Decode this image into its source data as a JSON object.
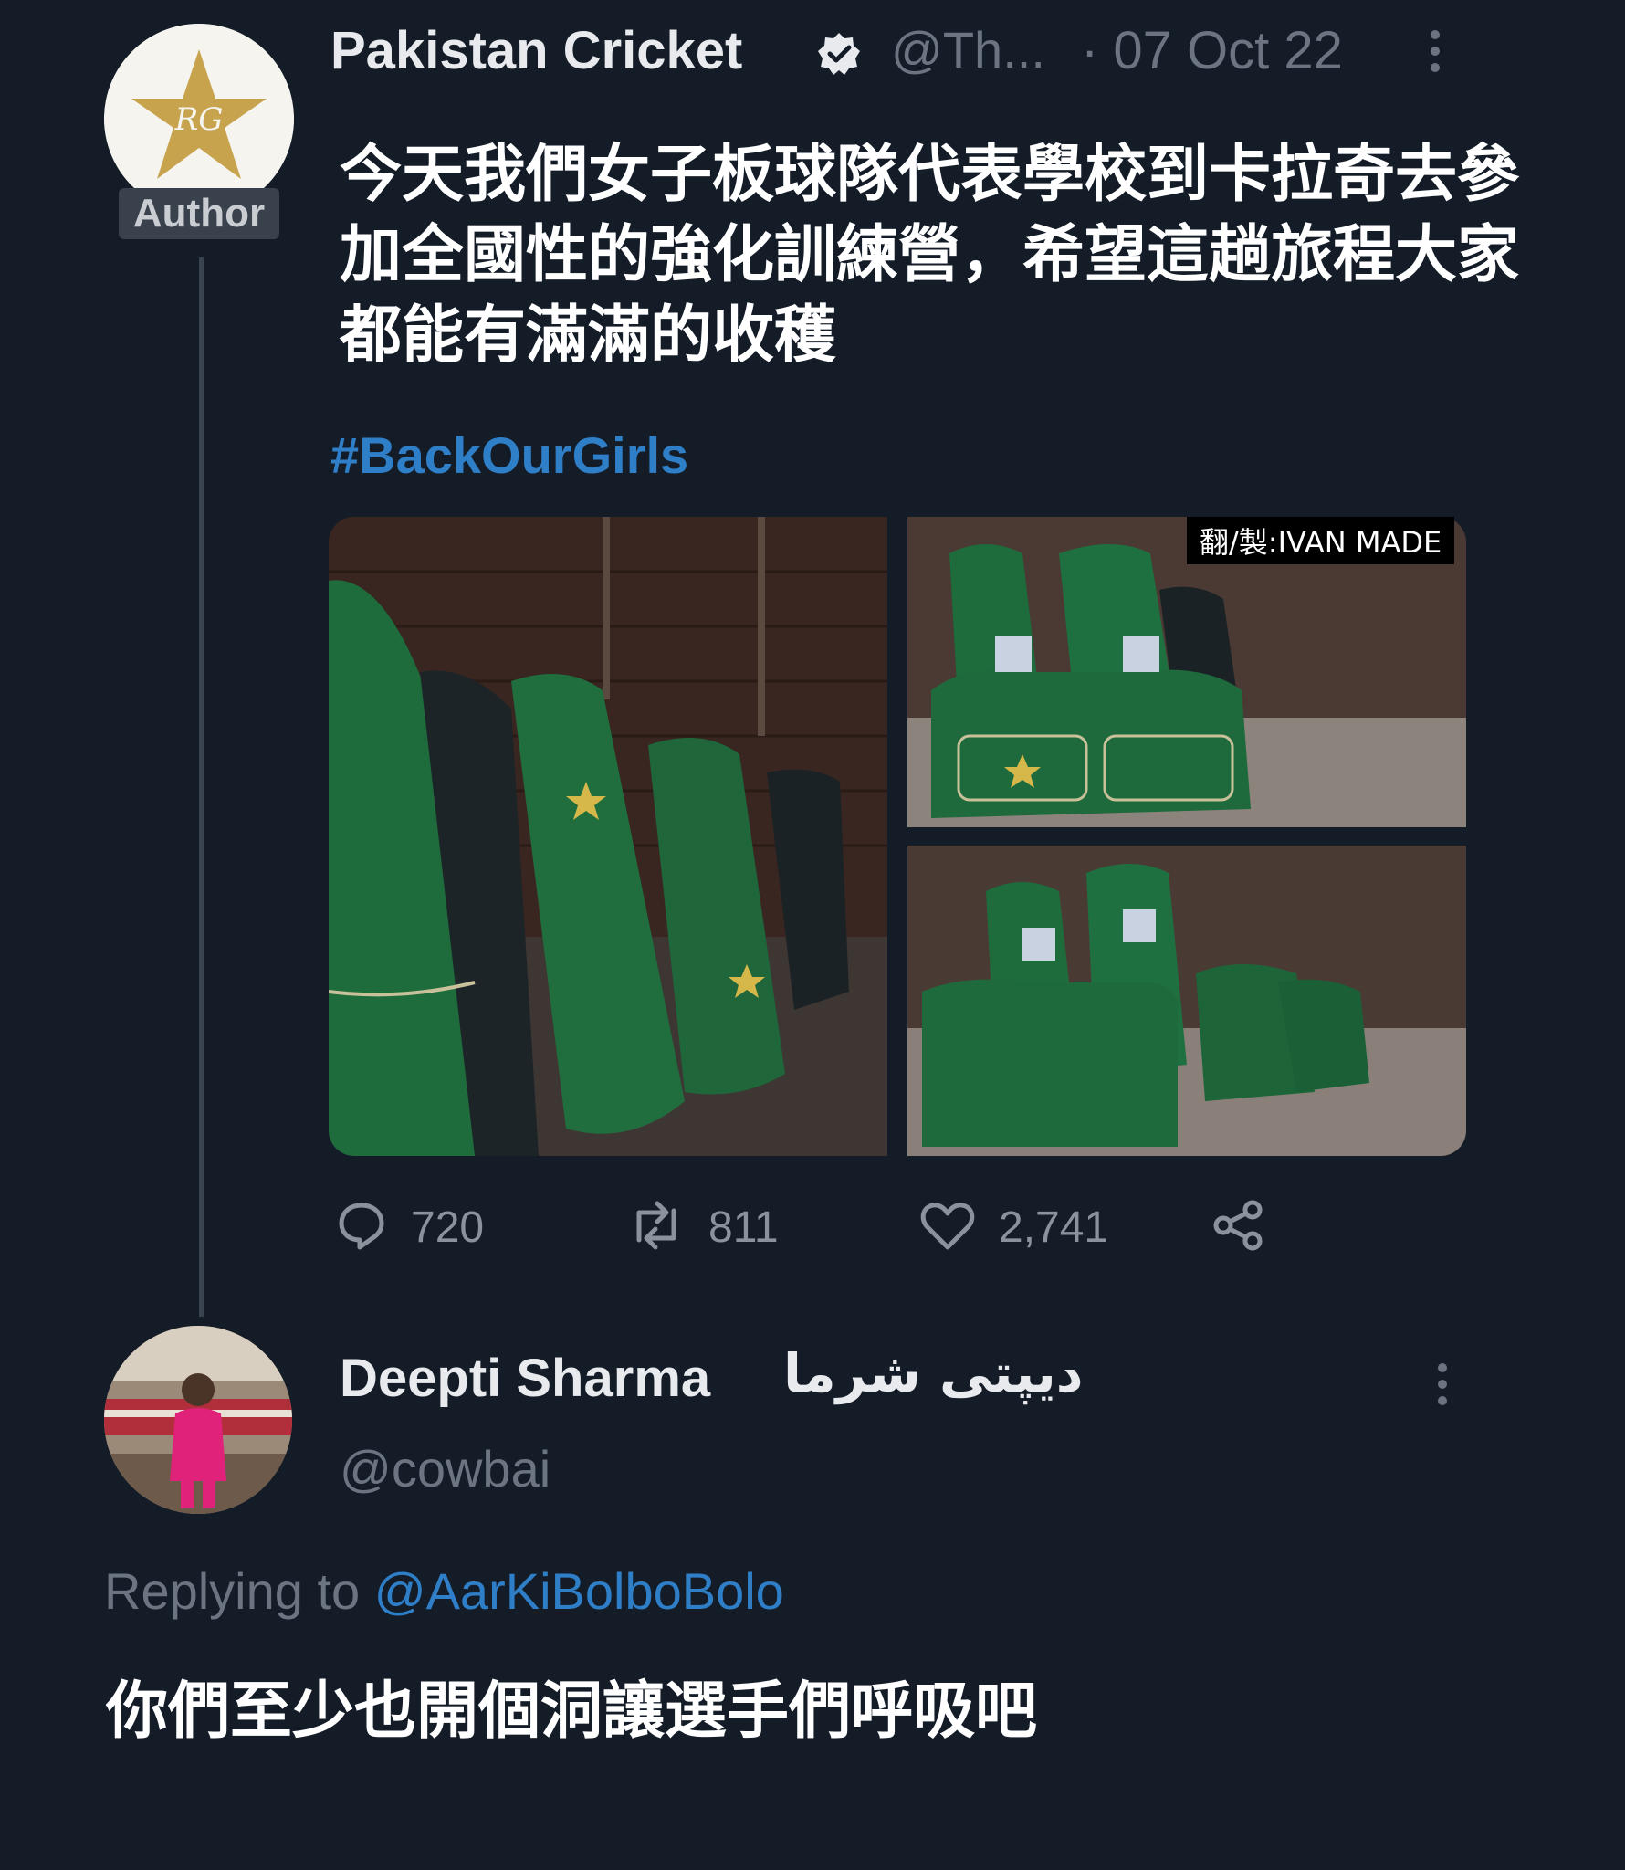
{
  "tweet": {
    "author_name": "Pakistan Cricket",
    "author_handle": "@Th...",
    "date": "· 07 Oct 22",
    "author_badge": "Author",
    "text": "今天我們女子板球隊代表學校到卡拉奇去參加全國性的強化訓練營，希望這趟旅程大家都能有滿滿的收穫",
    "hashtag": "#BackOurGirls",
    "media_watermark": "翻/製:IVAN MADE",
    "stats": {
      "replies": "720",
      "retweets": "811",
      "likes": "2,741"
    },
    "colors": {
      "link": "#2f7fc8",
      "bag_green": "#1e6b3c"
    }
  },
  "reply": {
    "author_name": "Deepti Sharma",
    "author_name_urdu": "دیپتی شرما",
    "author_handle": "@cowbai",
    "replying_prefix": "Replying to",
    "replying_mention": "@AarKiBolboBolo",
    "text": "你們至少也開個洞讓選手們呼吸吧"
  },
  "icons": [
    "verified-icon",
    "more-icon",
    "reply-icon",
    "retweet-icon",
    "like-icon",
    "share-icon"
  ]
}
